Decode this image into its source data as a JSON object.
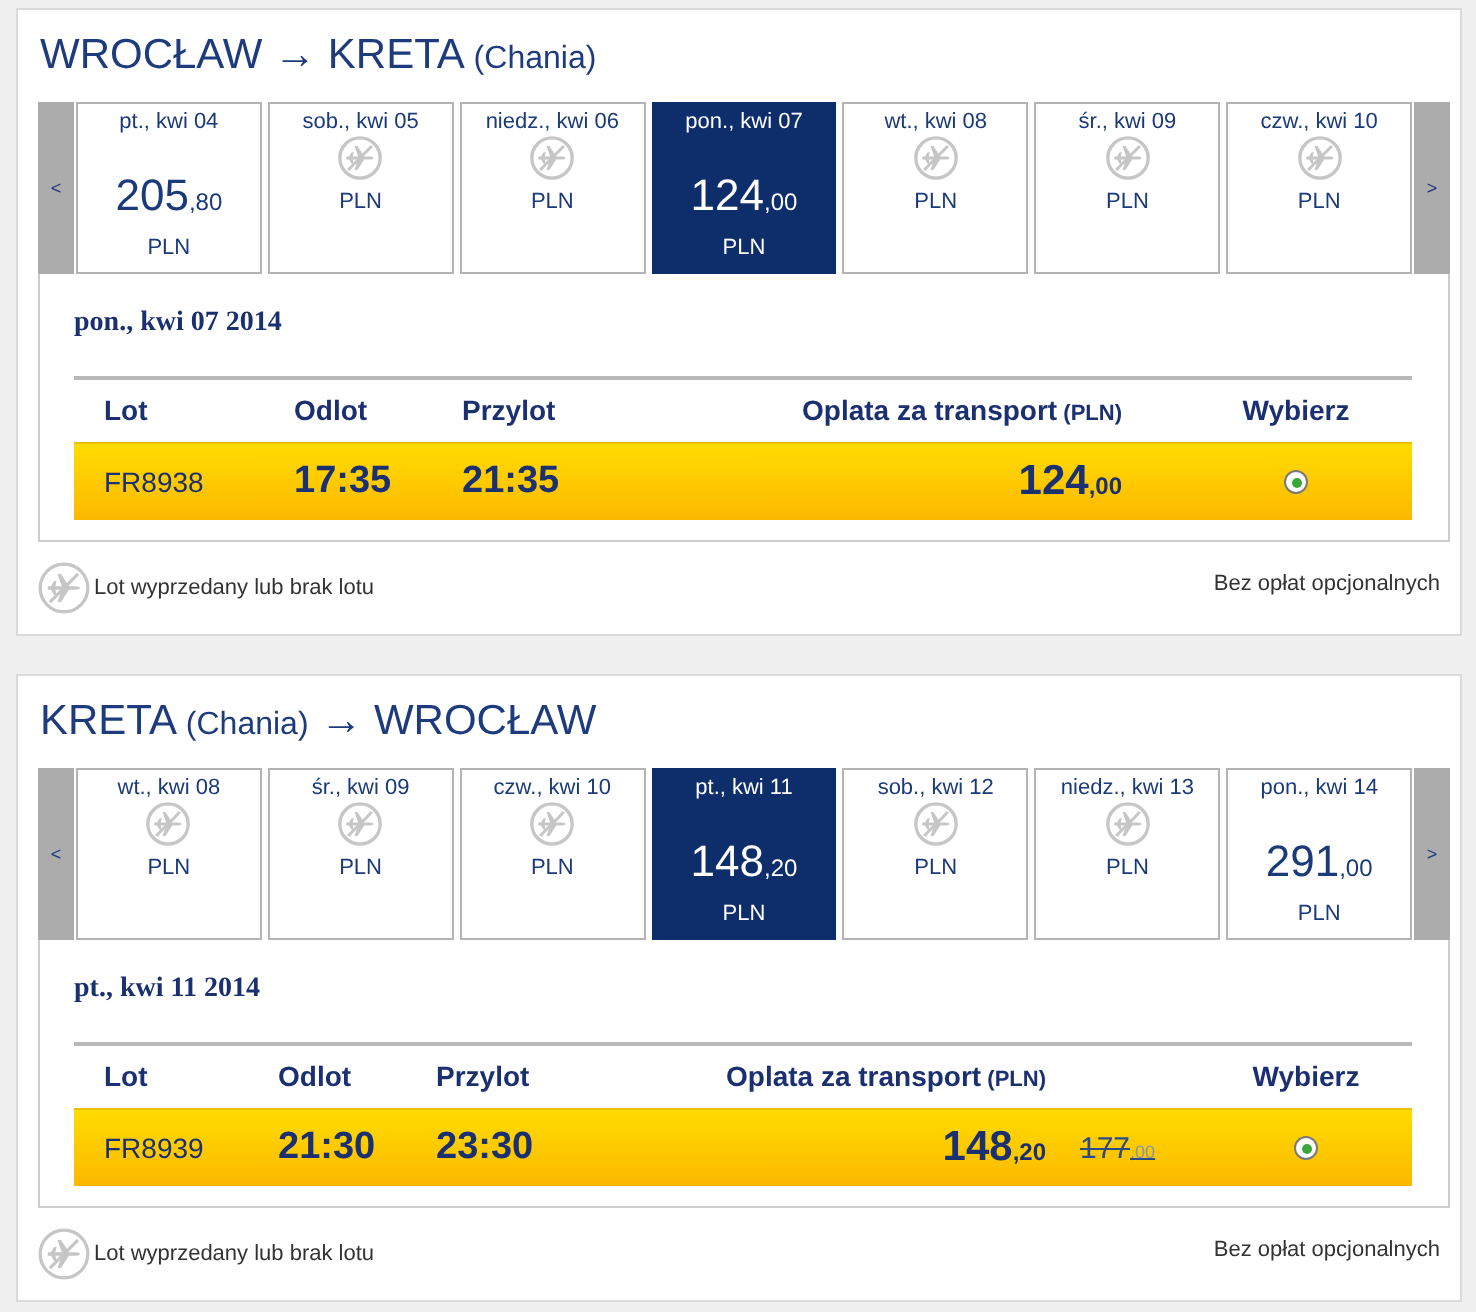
{
  "journeys": [
    {
      "title": [
        {
          "text": "WROCŁAW",
          "kind": "city"
        },
        {
          "text": "→",
          "kind": "arrow"
        },
        {
          "text": "KRETA",
          "kind": "city"
        },
        {
          "text": "(Chania)",
          "kind": "airport"
        }
      ],
      "date_strip": {
        "prev": "<",
        "next": ">",
        "days": [
          {
            "date": "pt., kwi 04",
            "kind": "fare",
            "price": {
              "whole": "205",
              "decimals": ",80"
            },
            "currency": "PLN",
            "selected": false
          },
          {
            "date": "sob., kwi 05",
            "kind": "no_flight",
            "currency": "PLN",
            "selected": false
          },
          {
            "date": "niedz., kwi 06",
            "kind": "no_flight",
            "currency": "PLN",
            "selected": false
          },
          {
            "date": "pon., kwi 07",
            "kind": "fare",
            "price": {
              "whole": "124",
              "decimals": ",00"
            },
            "currency": "PLN",
            "selected": true
          },
          {
            "date": "wt., kwi 08",
            "kind": "no_flight",
            "currency": "PLN",
            "selected": false
          },
          {
            "date": "śr., kwi 09",
            "kind": "no_flight",
            "currency": "PLN",
            "selected": false
          },
          {
            "date": "czw., kwi 10",
            "kind": "no_flight",
            "currency": "PLN",
            "selected": false
          }
        ]
      },
      "selected_date": "pon., kwi 07 2014",
      "table": {
        "columns": [
          {
            "label": "Lot",
            "kind": "flight"
          },
          {
            "label": "Odlot",
            "kind": "departure"
          },
          {
            "label": "Przylot",
            "kind": "arrival"
          },
          {
            "label": "Oplata za transport",
            "unit": "(PLN)",
            "kind": "fare"
          },
          {
            "label": "Wybierz",
            "kind": "select"
          }
        ],
        "rows": [
          {
            "flight": "FR8938",
            "departure": "17:35",
            "arrival": "21:35",
            "fare": {
              "whole": "124",
              "decimals": ",00"
            },
            "selected": true
          }
        ]
      },
      "legend": "Lot wyprzedany lub brak lotu",
      "note": "Bez opłat opcjonalnych"
    },
    {
      "title": [
        {
          "text": "KRETA",
          "kind": "city"
        },
        {
          "text": "(Chania)",
          "kind": "airport"
        },
        {
          "text": "→",
          "kind": "arrow"
        },
        {
          "text": "WROCŁAW",
          "kind": "city"
        }
      ],
      "date_strip": {
        "prev": "<",
        "next": ">",
        "days": [
          {
            "date": "wt., kwi 08",
            "kind": "no_flight",
            "currency": "PLN",
            "selected": false
          },
          {
            "date": "śr., kwi 09",
            "kind": "no_flight",
            "currency": "PLN",
            "selected": false
          },
          {
            "date": "czw., kwi 10",
            "kind": "no_flight",
            "currency": "PLN",
            "selected": false
          },
          {
            "date": "pt., kwi 11",
            "kind": "fare",
            "price": {
              "whole": "148",
              "decimals": ",20"
            },
            "currency": "PLN",
            "selected": true
          },
          {
            "date": "sob., kwi 12",
            "kind": "no_flight",
            "currency": "PLN",
            "selected": false
          },
          {
            "date": "niedz., kwi 13",
            "kind": "no_flight",
            "currency": "PLN",
            "selected": false
          },
          {
            "date": "pon., kwi 14",
            "kind": "fare",
            "price": {
              "whole": "291",
              "decimals": ",00"
            },
            "currency": "PLN",
            "selected": false
          }
        ]
      },
      "selected_date": "pt., kwi 11 2014",
      "table": {
        "columns": [
          {
            "label": "Lot",
            "kind": "flight"
          },
          {
            "label": "Odlot",
            "kind": "departure"
          },
          {
            "label": "Przylot",
            "kind": "arrival"
          },
          {
            "label": "Oplata za transport",
            "unit": "(PLN)",
            "kind": "fare"
          },
          {
            "label": "Wybierz",
            "kind": "select"
          }
        ],
        "rows": [
          {
            "flight": "FR8939",
            "departure": "21:30",
            "arrival": "23:30",
            "fare": {
              "whole": "148",
              "decimals": ",20"
            },
            "old_fare": {
              "whole": "177",
              "decimals": ",00"
            },
            "selected": true
          }
        ]
      },
      "legend": "Lot wyprzedany lub brak lotu",
      "note": "Bez opłat opcjonalnych"
    }
  ]
}
